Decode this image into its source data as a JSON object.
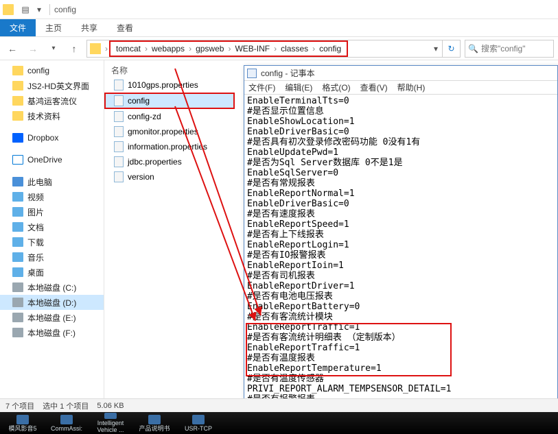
{
  "titlebar": {
    "title": "config"
  },
  "ribbon": {
    "file": "文件",
    "tabs": [
      "主页",
      "共享",
      "查看"
    ]
  },
  "breadcrumbs": [
    "tomcat",
    "webapps",
    "gpsweb",
    "WEB-INF",
    "classes",
    "config"
  ],
  "search": {
    "placeholder": "搜索\"config\""
  },
  "tree": {
    "folders": [
      "config",
      "JS2-HD英文界面",
      "基鸿运客流仪",
      "技术资料"
    ],
    "dropbox": "Dropbox",
    "onedrive": "OneDrive",
    "pc": "此电脑",
    "libs": [
      "视频",
      "图片",
      "文档",
      "下载",
      "音乐",
      "桌面"
    ],
    "drives": [
      "本地磁盘 (C:)",
      "本地磁盘 (D:)",
      "本地磁盘 (E:)",
      "本地磁盘 (F:)"
    ],
    "drive_selected": 1
  },
  "file_header": "名称",
  "files": [
    "1010gps.properties",
    "config",
    "config-zd",
    "gmonitor.properties",
    "information.properties",
    "jdbc.properties",
    "version"
  ],
  "file_selected": 1,
  "status": {
    "count": "7 个项目",
    "selection": "选中 1 个项目",
    "size": "5.06 KB"
  },
  "notepad": {
    "title": "config - 记事本",
    "menu": {
      "file": "文件(F)",
      "edit": "编辑(E)",
      "format": "格式(O)",
      "view": "查看(V)",
      "help": "帮助(H)"
    },
    "content": "EnableTerminalTts=0\n#是否显示位置信息\nEnableShowLocation=1\nEnableDriverBasic=0\n#是否具有初次登录修改密码功能 0没有1有\nEnableUpdatePwd=1\n#是否为Sql Server数据库 0不是1是\nEnableSqlServer=0\n#是否有常规报表\nEnableReportNormal=1\nEnableDriverBasic=0\n#是否有速度报表\nEnableReportSpeed=1\n#是否有上下线报表\nEnableReportLogin=1\n#是否有IO报警报表\nEnableReportIoin=1\n#是否有司机报表\nEnableReportDriver=1\n#是否有电池电压报表\nEnableReportBattery=0\n#是否有客流统计模块\nEnableReportTraffic=1\n#是否有客流统计明细表 （定制版本）\nEnableReportTraffic=1\n#是否有温度报表\nEnableReportTemperature=1\n#是否有温度传感器\nPRIVI_REPORT_ALARM_TEMPSENSOR_DETAIL=1\n#是否有报警报表"
  },
  "taskbar": [
    "模风影音5",
    "CommAssi:",
    "Intelligent Vehicle ...",
    "产品说明书",
    "USR-TCP"
  ]
}
